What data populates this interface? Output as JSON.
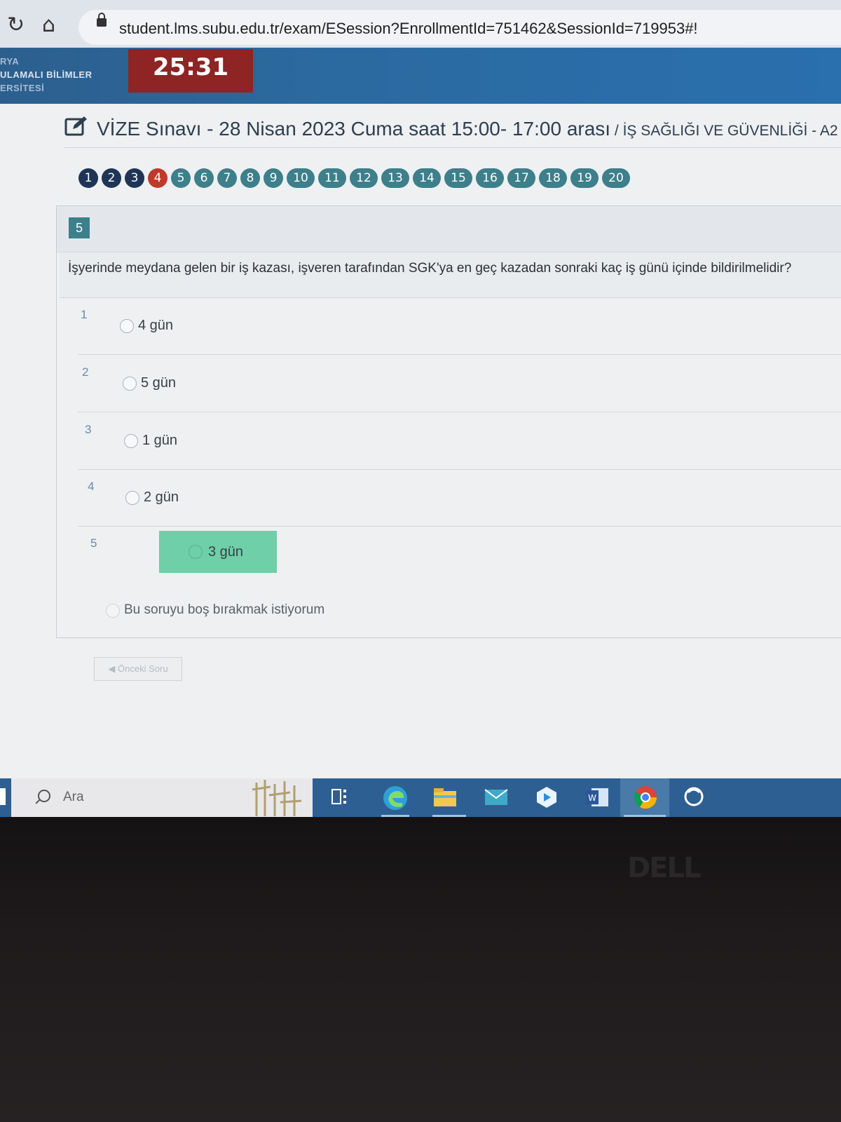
{
  "browser": {
    "url": "student.lms.subu.edu.tr/exam/ESession?EnrollmentId=751462&SessionId=719953#!"
  },
  "header": {
    "logo_lines": [
      "RYA",
      "ULAMALI BİLİMLER",
      "ERSİTESİ"
    ],
    "timer": "25:31"
  },
  "exam": {
    "title": "VİZE Sınavı - 28 Nisan 2023 Cuma saat 15:00- 17:00 arası",
    "course": " / İŞ SAĞLIĞI VE GÜVENLİĞİ - A2"
  },
  "navigator": {
    "questions": [
      "1",
      "2",
      "3",
      "4",
      "5",
      "6",
      "7",
      "8",
      "9",
      "10",
      "11",
      "12",
      "13",
      "14",
      "15",
      "16",
      "17",
      "18",
      "19",
      "20"
    ],
    "answered": [
      "1",
      "2",
      "3"
    ],
    "current": "4"
  },
  "question": {
    "number": "5",
    "text": "İşyerinde meydana gelen bir iş kazası, işveren tarafından SGK'ya en geç kazadan sonraki kaç iş günü içinde bildirilmelidir?",
    "options": [
      {
        "num": "1",
        "label": "4 gün"
      },
      {
        "num": "2",
        "label": "5 gün"
      },
      {
        "num": "3",
        "label": "1 gün"
      },
      {
        "num": "4",
        "label": "2 gün"
      },
      {
        "num": "5",
        "label": "3 gün"
      }
    ],
    "selected_option": "5",
    "skip_label": "Bu soruyu boş bırakmak istiyorum",
    "prev_button": "Önceki Soru"
  },
  "taskbar": {
    "search_placeholder": "Ara",
    "apps": [
      "task-view-icon",
      "edge-icon",
      "file-explorer-icon",
      "mail-icon",
      "zoom-icon",
      "word-icon",
      "chrome-icon",
      "wifi-icon"
    ]
  },
  "bezel": {
    "brand": "DELL"
  },
  "colors": {
    "timer_bg": "#8e2424",
    "nav_default": "#3d7f8a",
    "nav_answered": "#1e3557",
    "nav_current": "#c0392b",
    "selected_option": "#6fcfa8",
    "header_blue": "#2b6aa0"
  }
}
